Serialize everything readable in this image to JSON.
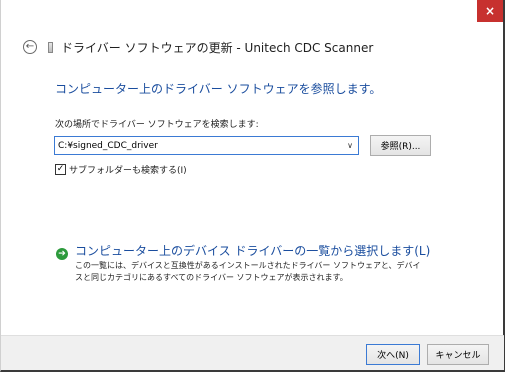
{
  "window": {
    "title": "ドライバー ソフトウェアの更新 - Unitech CDC Scanner",
    "close_glyph": "×"
  },
  "nav": {
    "back_glyph": "←"
  },
  "main": {
    "heading": "コンピューター上のドライバー ソフトウェアを参照します。",
    "search_label": "次の場所でドライバー ソフトウェアを検索します:",
    "path_value": "C:¥signed_CDC_driver",
    "combo_arrow": "∨",
    "browse_label": "参照(R)...",
    "subfolder_checked": true,
    "subfolder_check_glyph": "✓",
    "subfolder_label": "サブフォルダーも検索する(I)"
  },
  "pick": {
    "arrow_glyph": "➔",
    "title": "コンピューター上のデバイス ドライバーの一覧から選択します(L)",
    "description": "この一覧には、デバイスと互換性があるインストールされたドライバー ソフトウェアと、デバイスと同じカテゴリにあるすべてのドライバー ソフトウェアが表示されます。"
  },
  "footer": {
    "next_label": "次へ(N)",
    "cancel_label": "キャンセル"
  },
  "colors": {
    "accent": "#1a4d9e",
    "close": "#c7312f",
    "go_arrow": "#2c9a3c"
  }
}
